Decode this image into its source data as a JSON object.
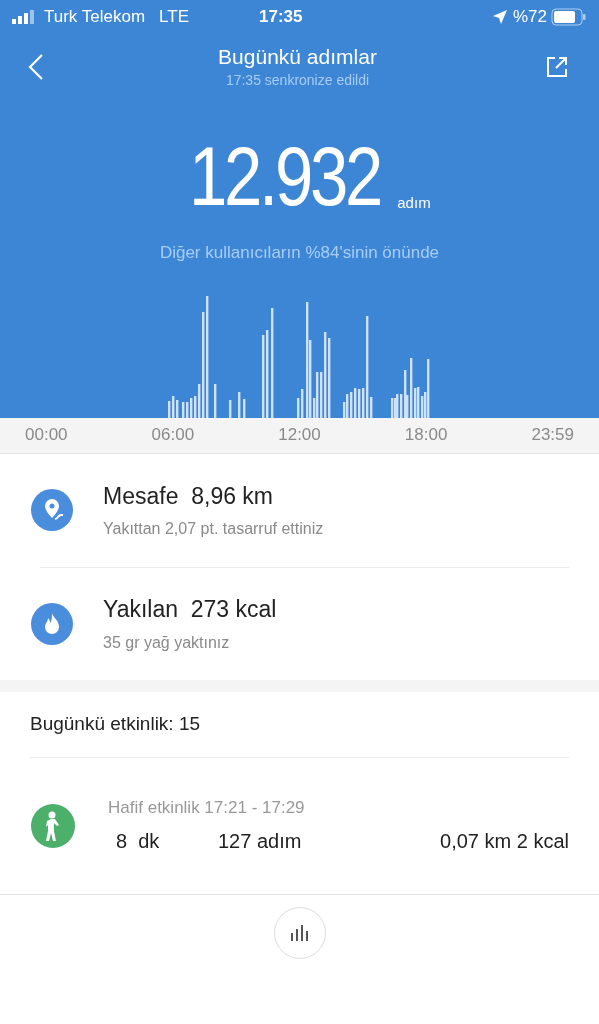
{
  "status_bar": {
    "carrier": "Turk Telekom",
    "network": "LTE",
    "time": "17:35",
    "battery": "%72"
  },
  "header": {
    "title": "Bugünkü adımlar",
    "subtitle": "17:35 senkronize edildi"
  },
  "summary": {
    "steps": "12.932",
    "unit": "adım",
    "rank": "Diğer kullanıcıların %84'sinin önünde"
  },
  "axis_labels": [
    "00:00",
    "06:00",
    "12:00",
    "18:00",
    "23:59"
  ],
  "stats": [
    {
      "kind": "distance",
      "title": "Mesafe  8,96 km",
      "note": "Yakıttan 2,07 pt. tasarruf ettiniz"
    },
    {
      "kind": "calories",
      "title": "Yakılan  273 kcal",
      "note": "35 gr yağ yaktınız"
    }
  ],
  "activity": {
    "heading": "Bugünkü etkinlik: 15",
    "items": [
      {
        "title": "Hafif etkinlik 17:21 - 17:29",
        "duration": "8  dk",
        "steps": "127 adım",
        "distance_cal": "0,07 km 2 kcal"
      }
    ]
  }
}
